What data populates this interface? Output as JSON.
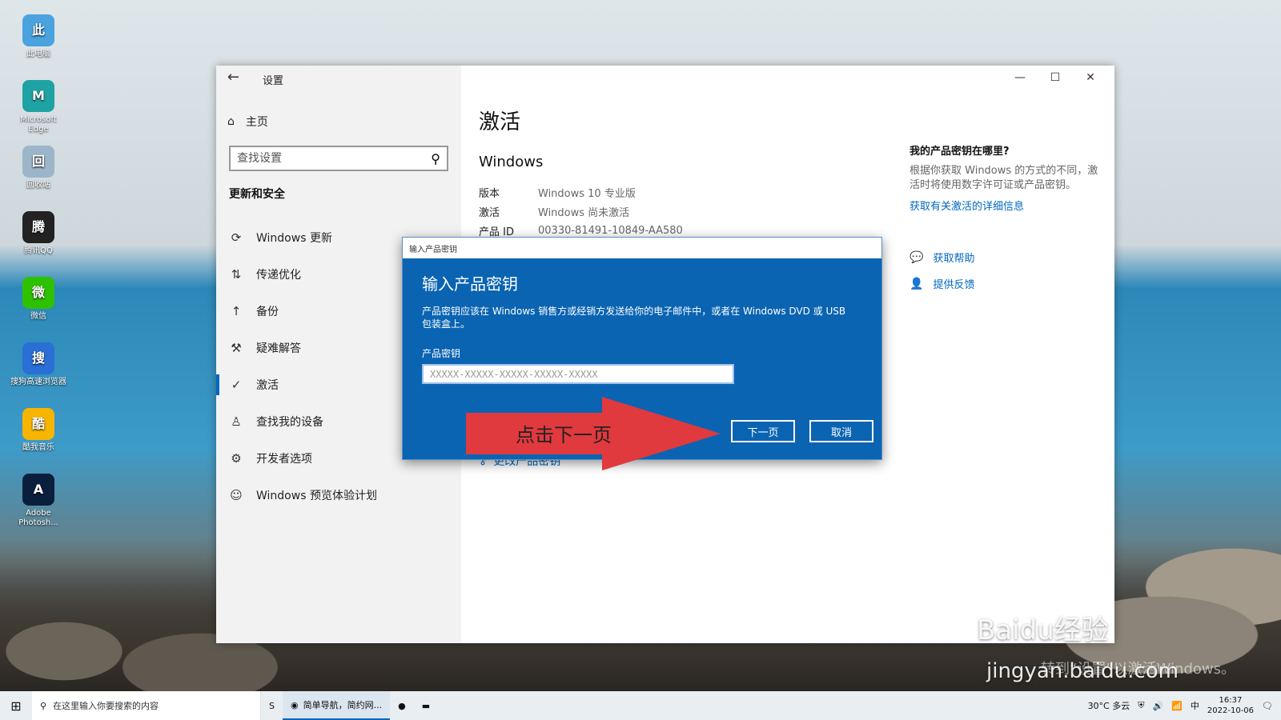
{
  "desktop": {
    "icons": [
      {
        "label": "此电脑",
        "icon": "computer-icon",
        "color": "#4aa3df"
      },
      {
        "label": "Microsoft Edge",
        "icon": "edge-icon",
        "color": "#1fa2a3"
      },
      {
        "label": "回收站",
        "icon": "recycle-bin-icon",
        "color": "#9cb6c9"
      },
      {
        "label": "腾讯QQ",
        "icon": "qq-icon",
        "color": "#222222"
      },
      {
        "label": "微信",
        "icon": "wechat-icon",
        "color": "#2dc100"
      },
      {
        "label": "搜狗高速浏览器",
        "icon": "sogou-icon",
        "color": "#2a6fd6"
      },
      {
        "label": "酷我音乐",
        "icon": "kuwo-icon",
        "color": "#f7b500"
      },
      {
        "label": "Adobe Photosh...",
        "icon": "photoshop-icon",
        "color": "#0a1f3c"
      }
    ]
  },
  "settings": {
    "title": "设置",
    "home": "主页",
    "search_placeholder": "查找设置",
    "section": "更新和安全",
    "nav": [
      {
        "label": "Windows 更新",
        "icon": "refresh-icon"
      },
      {
        "label": "传递优化",
        "icon": "delivery-icon"
      },
      {
        "label": "备份",
        "icon": "backup-icon"
      },
      {
        "label": "疑难解答",
        "icon": "wrench-icon"
      },
      {
        "label": "激活",
        "icon": "check-circle-icon"
      },
      {
        "label": "查找我的设备",
        "icon": "person-icon"
      },
      {
        "label": "开发者选项",
        "icon": "developer-icon"
      },
      {
        "label": "Windows 预览体验计划",
        "icon": "insider-icon"
      }
    ],
    "active_index": 4
  },
  "main": {
    "page_title": "激活",
    "sub_title": "Windows",
    "info": [
      {
        "key": "版本",
        "value": "Windows 10 专业版"
      },
      {
        "key": "激活",
        "value": "Windows 尚未激活"
      },
      {
        "key": "产品 ID",
        "value": "00330-81491-10849-AA580"
      }
    ],
    "change_key": "更改产品密钥"
  },
  "right_panel": {
    "heading": "我的产品密钥在哪里?",
    "text": "根据你获取 Windows 的方式的不同，激活时将使用数字许可证或产品密钥。",
    "link": "获取有关激活的详细信息",
    "help": "获取帮助",
    "feedback": "提供反馈"
  },
  "dialog": {
    "titlebar": "输入产品密钥",
    "heading": "输入产品密钥",
    "description": "产品密钥应该在 Windows 销售方或经销方发送给你的电子邮件中，或者在 Windows DVD 或 USB 包装盒上。",
    "field_label": "产品密钥",
    "placeholder": "XXXXX-XXXXX-XXXXX-XXXXX-XXXXX",
    "value": "",
    "next": "下一页",
    "cancel": "取消"
  },
  "annotation": {
    "text": "点击下一页",
    "color": "#e0393e"
  },
  "watermark": {
    "brand": "Baidu经验",
    "url": "jingyan.baidu.com",
    "faint": "转到“设置”以激活Windows。"
  },
  "taskbar": {
    "search_placeholder": "在这里输入你要搜索的内容",
    "apps": [
      "简单导航，简约网..."
    ],
    "weather": "30°C 多云",
    "time": "16:37",
    "date": "2022-10-06"
  }
}
